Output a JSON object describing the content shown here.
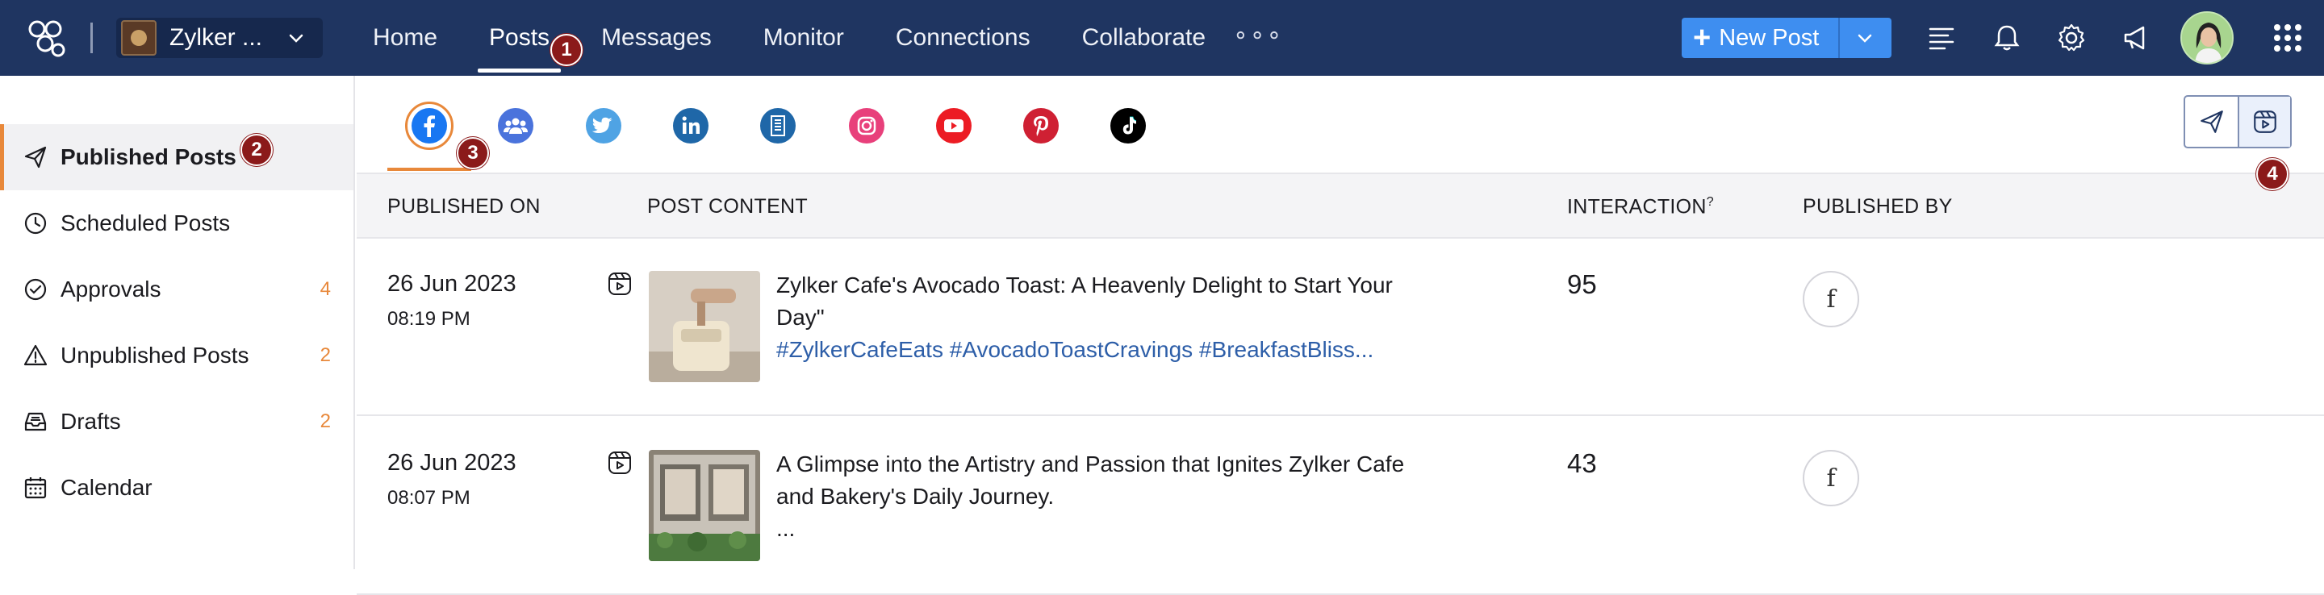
{
  "topbar": {
    "brand_name": "Zylker ...",
    "nav": [
      "Home",
      "Posts",
      "Messages",
      "Monitor",
      "Connections",
      "Collaborate"
    ],
    "active_nav": "Posts",
    "more": "∘∘∘",
    "new_post_label": "New Post",
    "new_post_plus": "+"
  },
  "sidebar": {
    "items": [
      {
        "label": "Published Posts",
        "count": ""
      },
      {
        "label": "Scheduled Posts",
        "count": ""
      },
      {
        "label": "Approvals",
        "count": "4"
      },
      {
        "label": "Unpublished Posts",
        "count": "2"
      },
      {
        "label": "Drafts",
        "count": "2"
      },
      {
        "label": "Calendar",
        "count": ""
      }
    ]
  },
  "channels": [
    "facebook",
    "facebook-groups",
    "twitter",
    "linkedin",
    "linkedin-pages",
    "instagram",
    "youtube",
    "pinterest",
    "tiktok"
  ],
  "table": {
    "headers": {
      "published_on": "PUBLISHED ON",
      "post_content": "POST CONTENT",
      "interaction": "INTERACTION",
      "interaction_help": "?",
      "published_by": "PUBLISHED BY"
    },
    "rows": [
      {
        "date": "26 Jun 2023",
        "time": "08:19 PM",
        "text": "Zylker Cafe's Avocado Toast: A Heavenly Delight to Start Your Day\"",
        "tags": "#ZylkerCafeEats #AvocadoToastCravings #BreakfastBliss...",
        "interaction": "95",
        "publisher": "f"
      },
      {
        "date": "26 Jun 2023",
        "time": "08:07 PM",
        "text": "A Glimpse into the Artistry and Passion that Ignites Zylker Cafe and Bakery's Daily Journey.",
        "tags": "...",
        "interaction": "43",
        "publisher": "f"
      }
    ]
  },
  "badges": [
    "1",
    "2",
    "3",
    "4"
  ],
  "colors": {
    "topbar": "#1f3561",
    "accent": "#e8883a",
    "primary_button": "#3e8ef0",
    "badge": "#8b1a1a",
    "hashtag": "#2d5ea8"
  }
}
